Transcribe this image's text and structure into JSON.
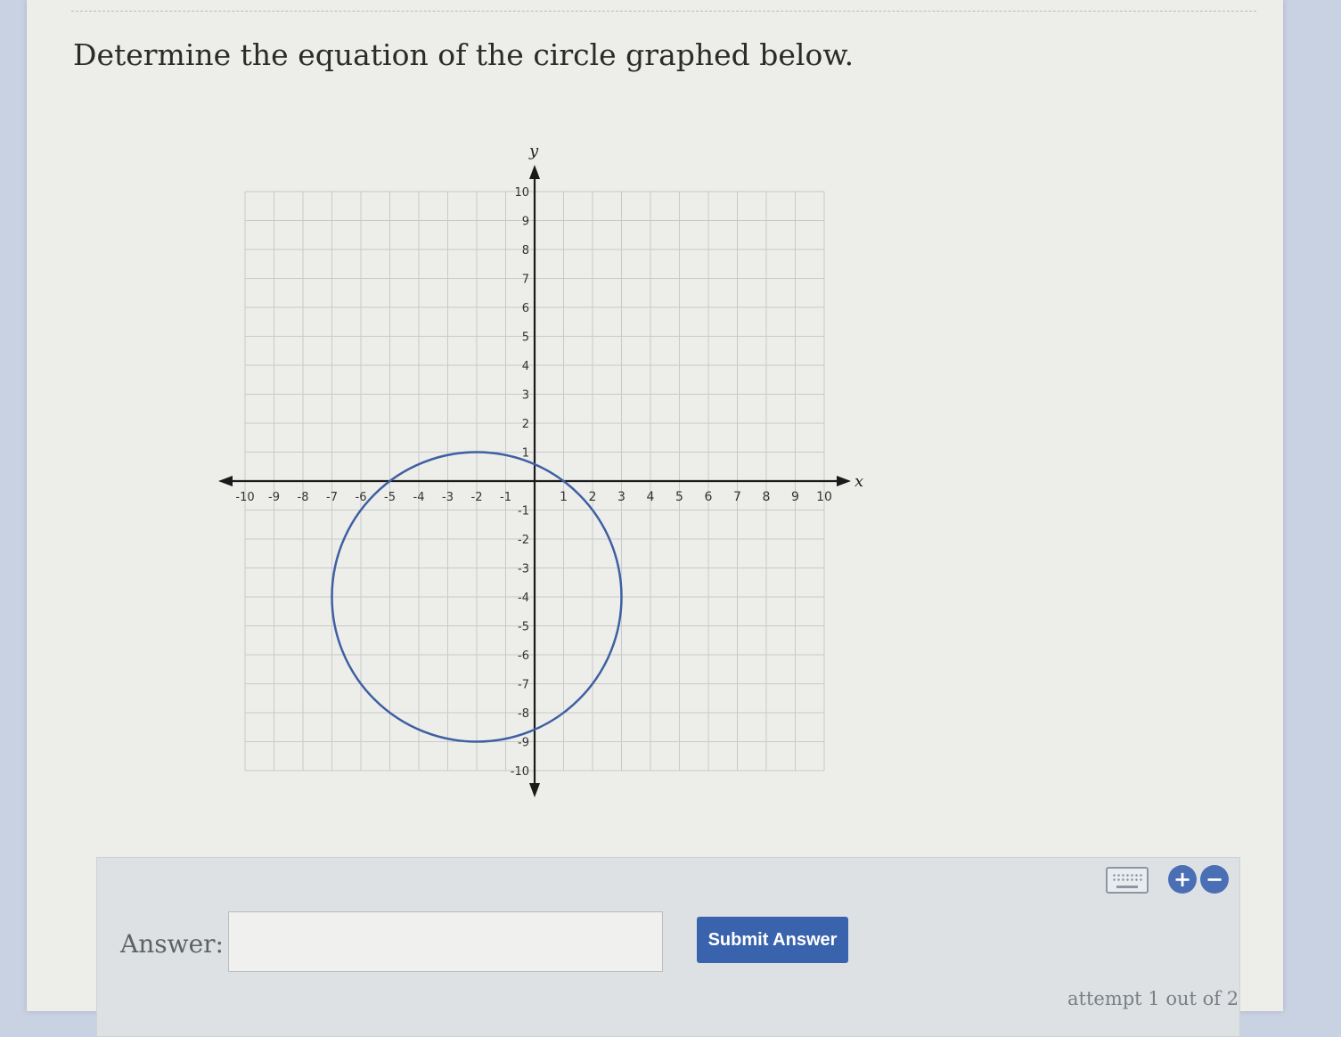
{
  "question": {
    "text": "Determine the equation of the circle graphed below."
  },
  "graph": {
    "x_axis_label": "x",
    "y_axis_label": "y",
    "x_tick_labels": [
      "-10",
      "-9",
      "-8",
      "-7",
      "-6",
      "-5",
      "-4",
      "-3",
      "-2",
      "-1",
      "1",
      "2",
      "3",
      "4",
      "5",
      "6",
      "7",
      "8",
      "9",
      "10"
    ],
    "y_tick_labels": [
      "10",
      "9",
      "8",
      "7",
      "6",
      "5",
      "4",
      "3",
      "2",
      "1",
      "-1",
      "-2",
      "-3",
      "-4",
      "-5",
      "-6",
      "-7",
      "-8",
      "-9",
      "-10"
    ],
    "circle_color": "#3f5fa3"
  },
  "chart_data": {
    "type": "scatter",
    "xlim": [
      -10,
      10
    ],
    "ylim": [
      -10,
      10
    ],
    "grid": true,
    "circle": {
      "center": [
        -2,
        -4
      ],
      "radius": 5
    }
  },
  "answer": {
    "label": "Answer:",
    "input_value": "",
    "submit_label": "Submit Answer",
    "attempt_text": "attempt 1 out of 2"
  },
  "toolbar": {
    "keyboard_icon": "keyboard-icon",
    "plus_icon": "plus-icon",
    "minus_icon": "minus-icon",
    "plus_symbol": "+",
    "minus_symbol": "−"
  }
}
